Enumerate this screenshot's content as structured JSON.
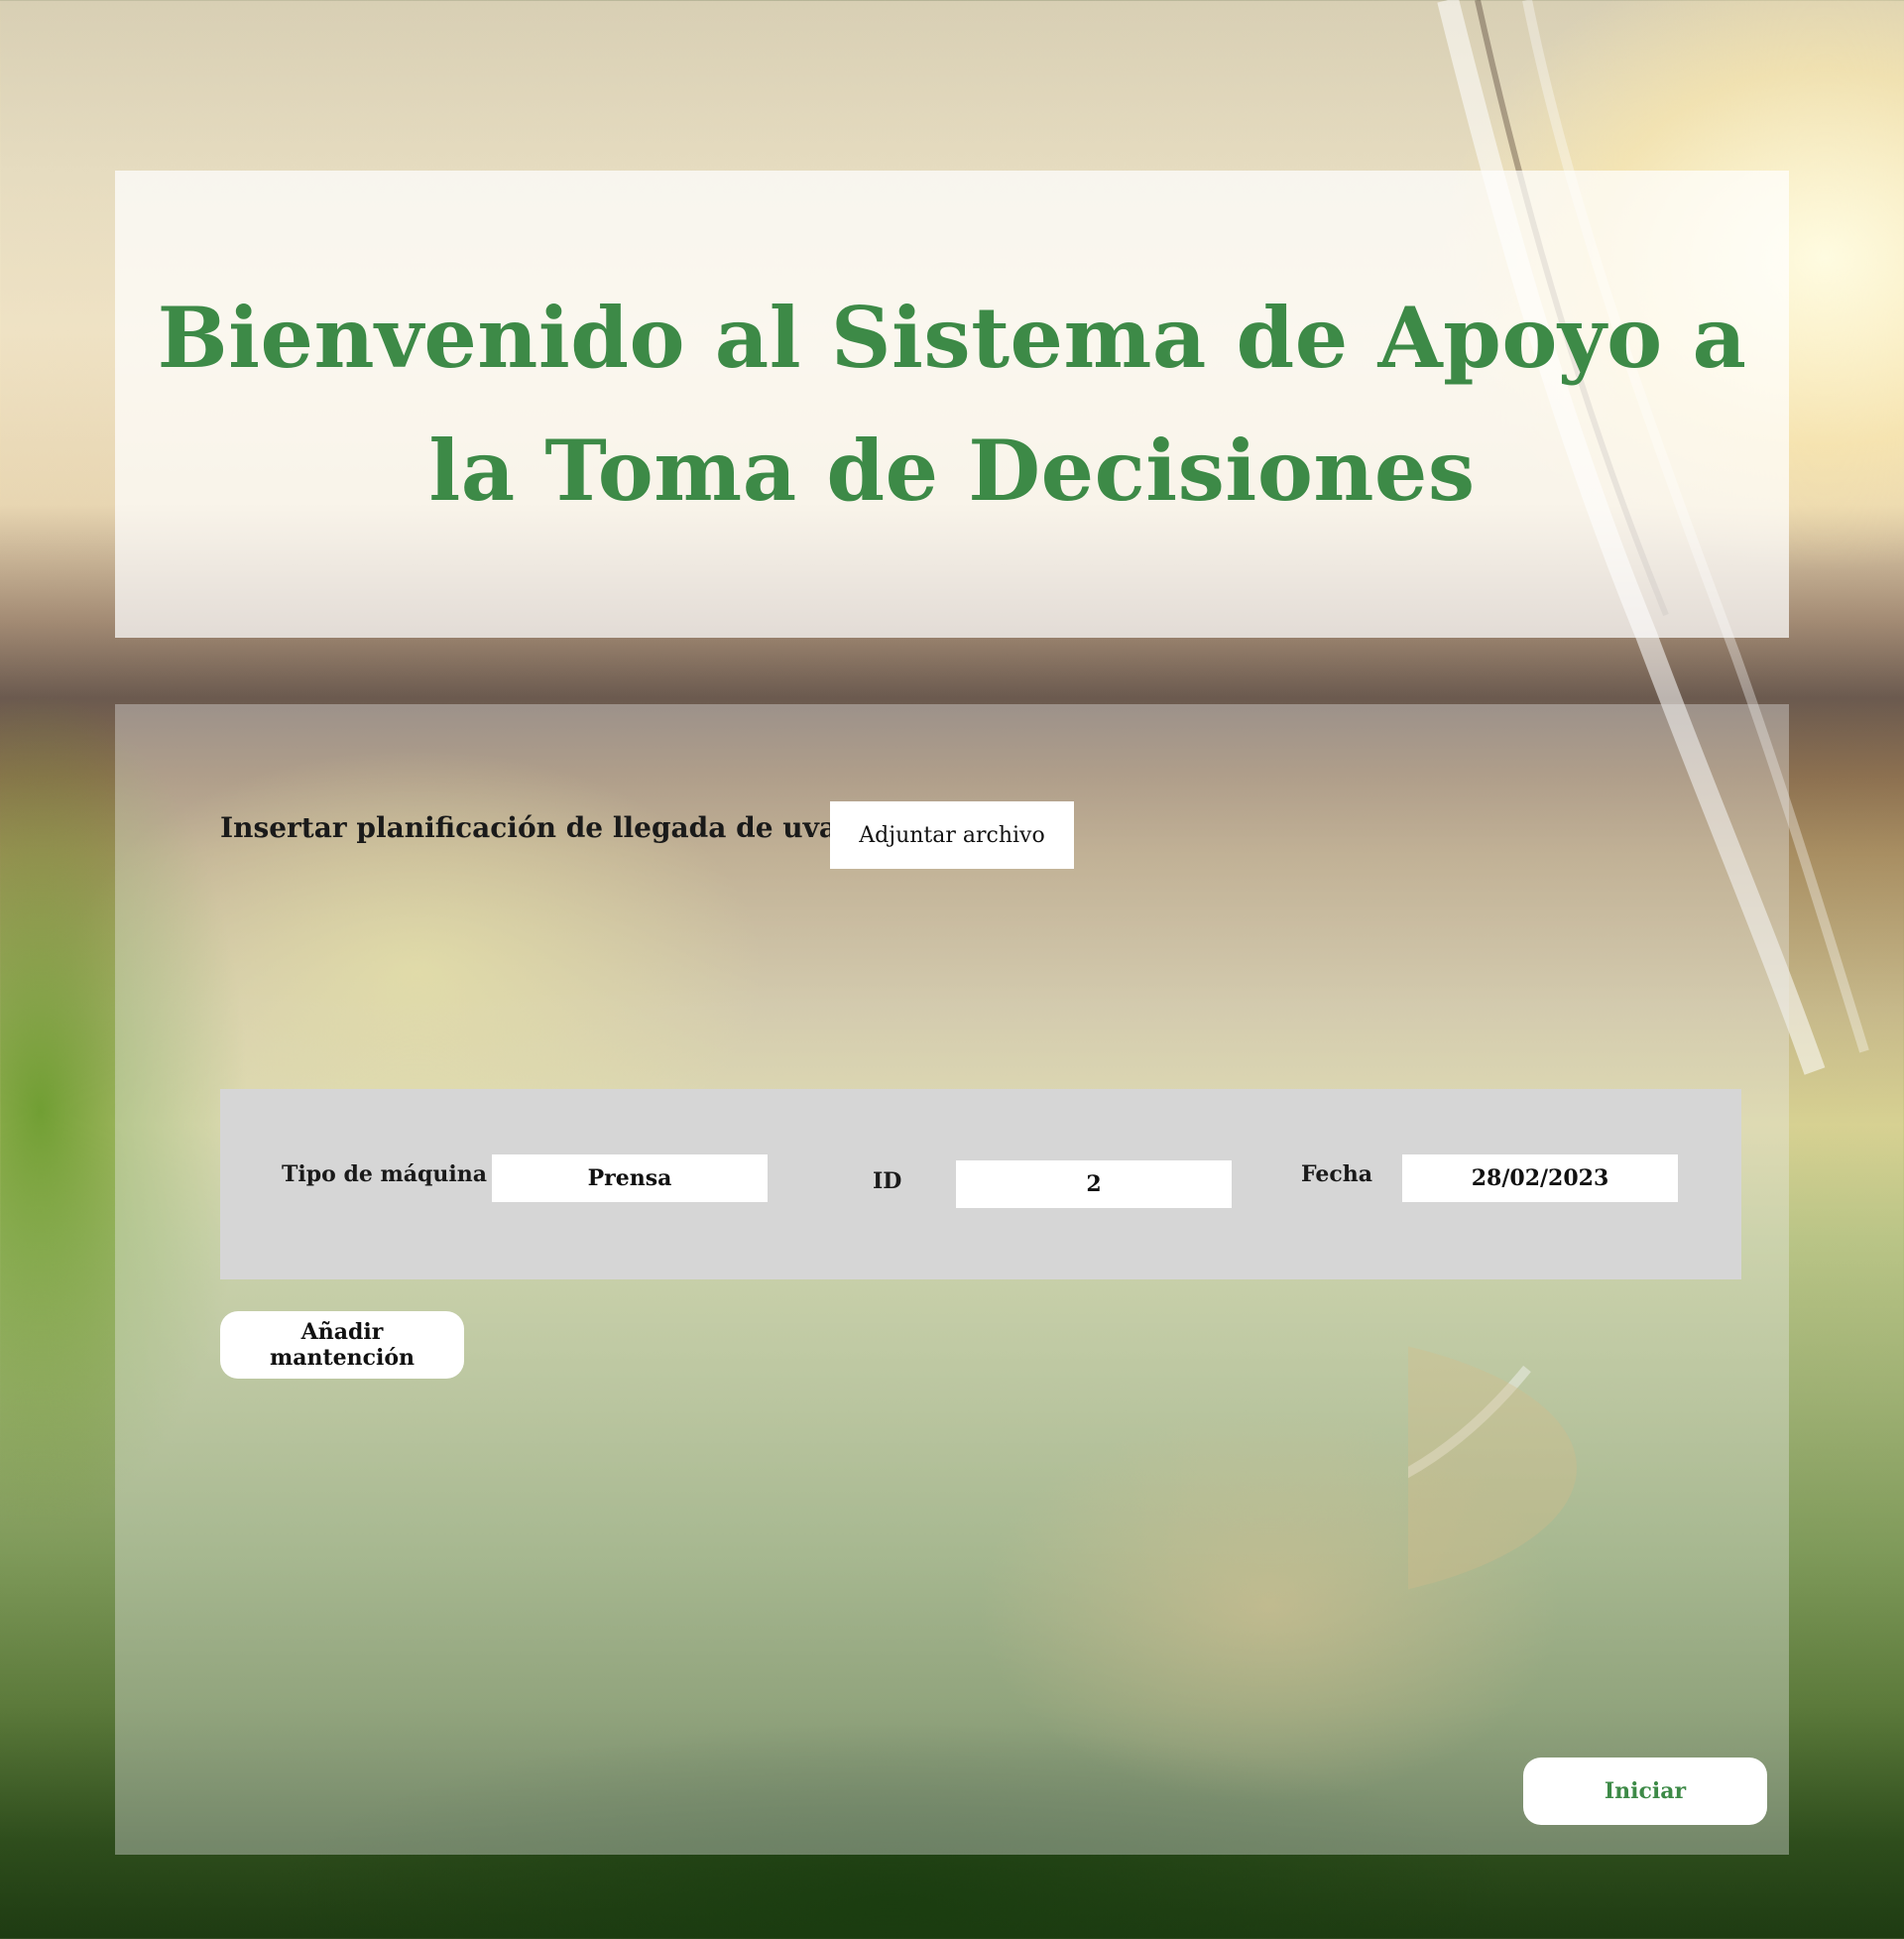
{
  "header": {
    "title": "Bienvenido al Sistema de Apoyo a la Toma de Decisiones"
  },
  "upload": {
    "label": "Insertar planificación de llegada de uvas",
    "attach_button": "Adjuntar archivo"
  },
  "maintenance": {
    "machine_type_label": "Tipo de máquina",
    "machine_type_value": "Prensa",
    "id_label": "ID",
    "id_value": "2",
    "date_label": "Fecha",
    "date_value": "28/02/2023",
    "add_button": "Añadir mantención"
  },
  "actions": {
    "start_button": "Iniciar"
  },
  "colors": {
    "accent_green": "#3d8a47",
    "panel_gray": "#d6d6d6"
  }
}
